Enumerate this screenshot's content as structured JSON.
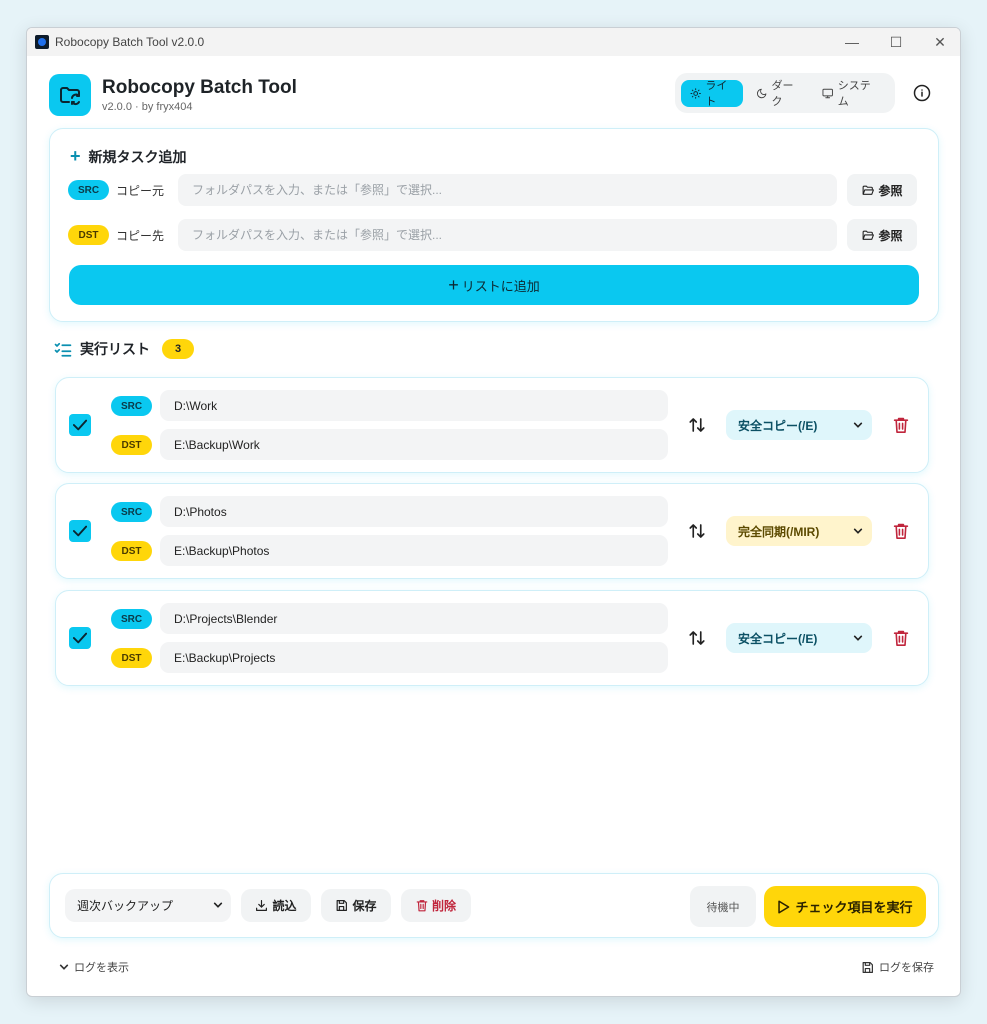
{
  "window": {
    "title": "Robocopy Batch Tool  v2.0.0",
    "controls": {
      "minimize": "—",
      "maximize": "☐",
      "close": "✕"
    }
  },
  "header": {
    "app_name": "Robocopy Batch Tool",
    "subtitle": "v2.0.0 · by fryx404",
    "theme_options": [
      {
        "label": "ライト",
        "icon": "sun-icon",
        "active": true
      },
      {
        "label": "ダーク",
        "icon": "moon-icon",
        "active": false
      },
      {
        "label": "システム",
        "icon": "monitor-icon",
        "active": false
      }
    ]
  },
  "new_task": {
    "title": "新規タスク追加",
    "src": {
      "badge": "SRC",
      "label": "コピー元",
      "placeholder": "フォルダパスを入力、または「参照」で選択...",
      "value": ""
    },
    "dst": {
      "badge": "DST",
      "label": "コピー先",
      "placeholder": "フォルダパスを入力、または「参照」で選択...",
      "value": ""
    },
    "browse_label": "参照",
    "add_label": "リストに追加"
  },
  "list": {
    "title": "実行リスト",
    "count": "3",
    "tasks": [
      {
        "checked": true,
        "src_badge": "SRC",
        "dst_badge": "DST",
        "src": "D:\\Work",
        "dst": "E:\\Backup\\Work",
        "mode": "安全コピー(/E)",
        "mode_type": "copy"
      },
      {
        "checked": true,
        "src_badge": "SRC",
        "dst_badge": "DST",
        "src": "D:\\Photos",
        "dst": "E:\\Backup\\Photos",
        "mode": "完全同期(/MIR)",
        "mode_type": "mir"
      },
      {
        "checked": true,
        "src_badge": "SRC",
        "dst_badge": "DST",
        "src": "D:\\Projects\\Blender",
        "dst": "E:\\Backup\\Projects",
        "mode": "安全コピー(/E)",
        "mode_type": "copy"
      }
    ]
  },
  "footer": {
    "preset": "週次バックアップ",
    "load_label": "読込",
    "save_label": "保存",
    "delete_label": "削除",
    "status": "待機中",
    "run_label": "チェック項目を実行"
  },
  "log": {
    "toggle_label": "ログを表示",
    "save_label": "ログを保存"
  },
  "colors": {
    "accent": "#0ac8f0",
    "dst_yellow": "#ffd60a",
    "danger": "#c0253c"
  }
}
